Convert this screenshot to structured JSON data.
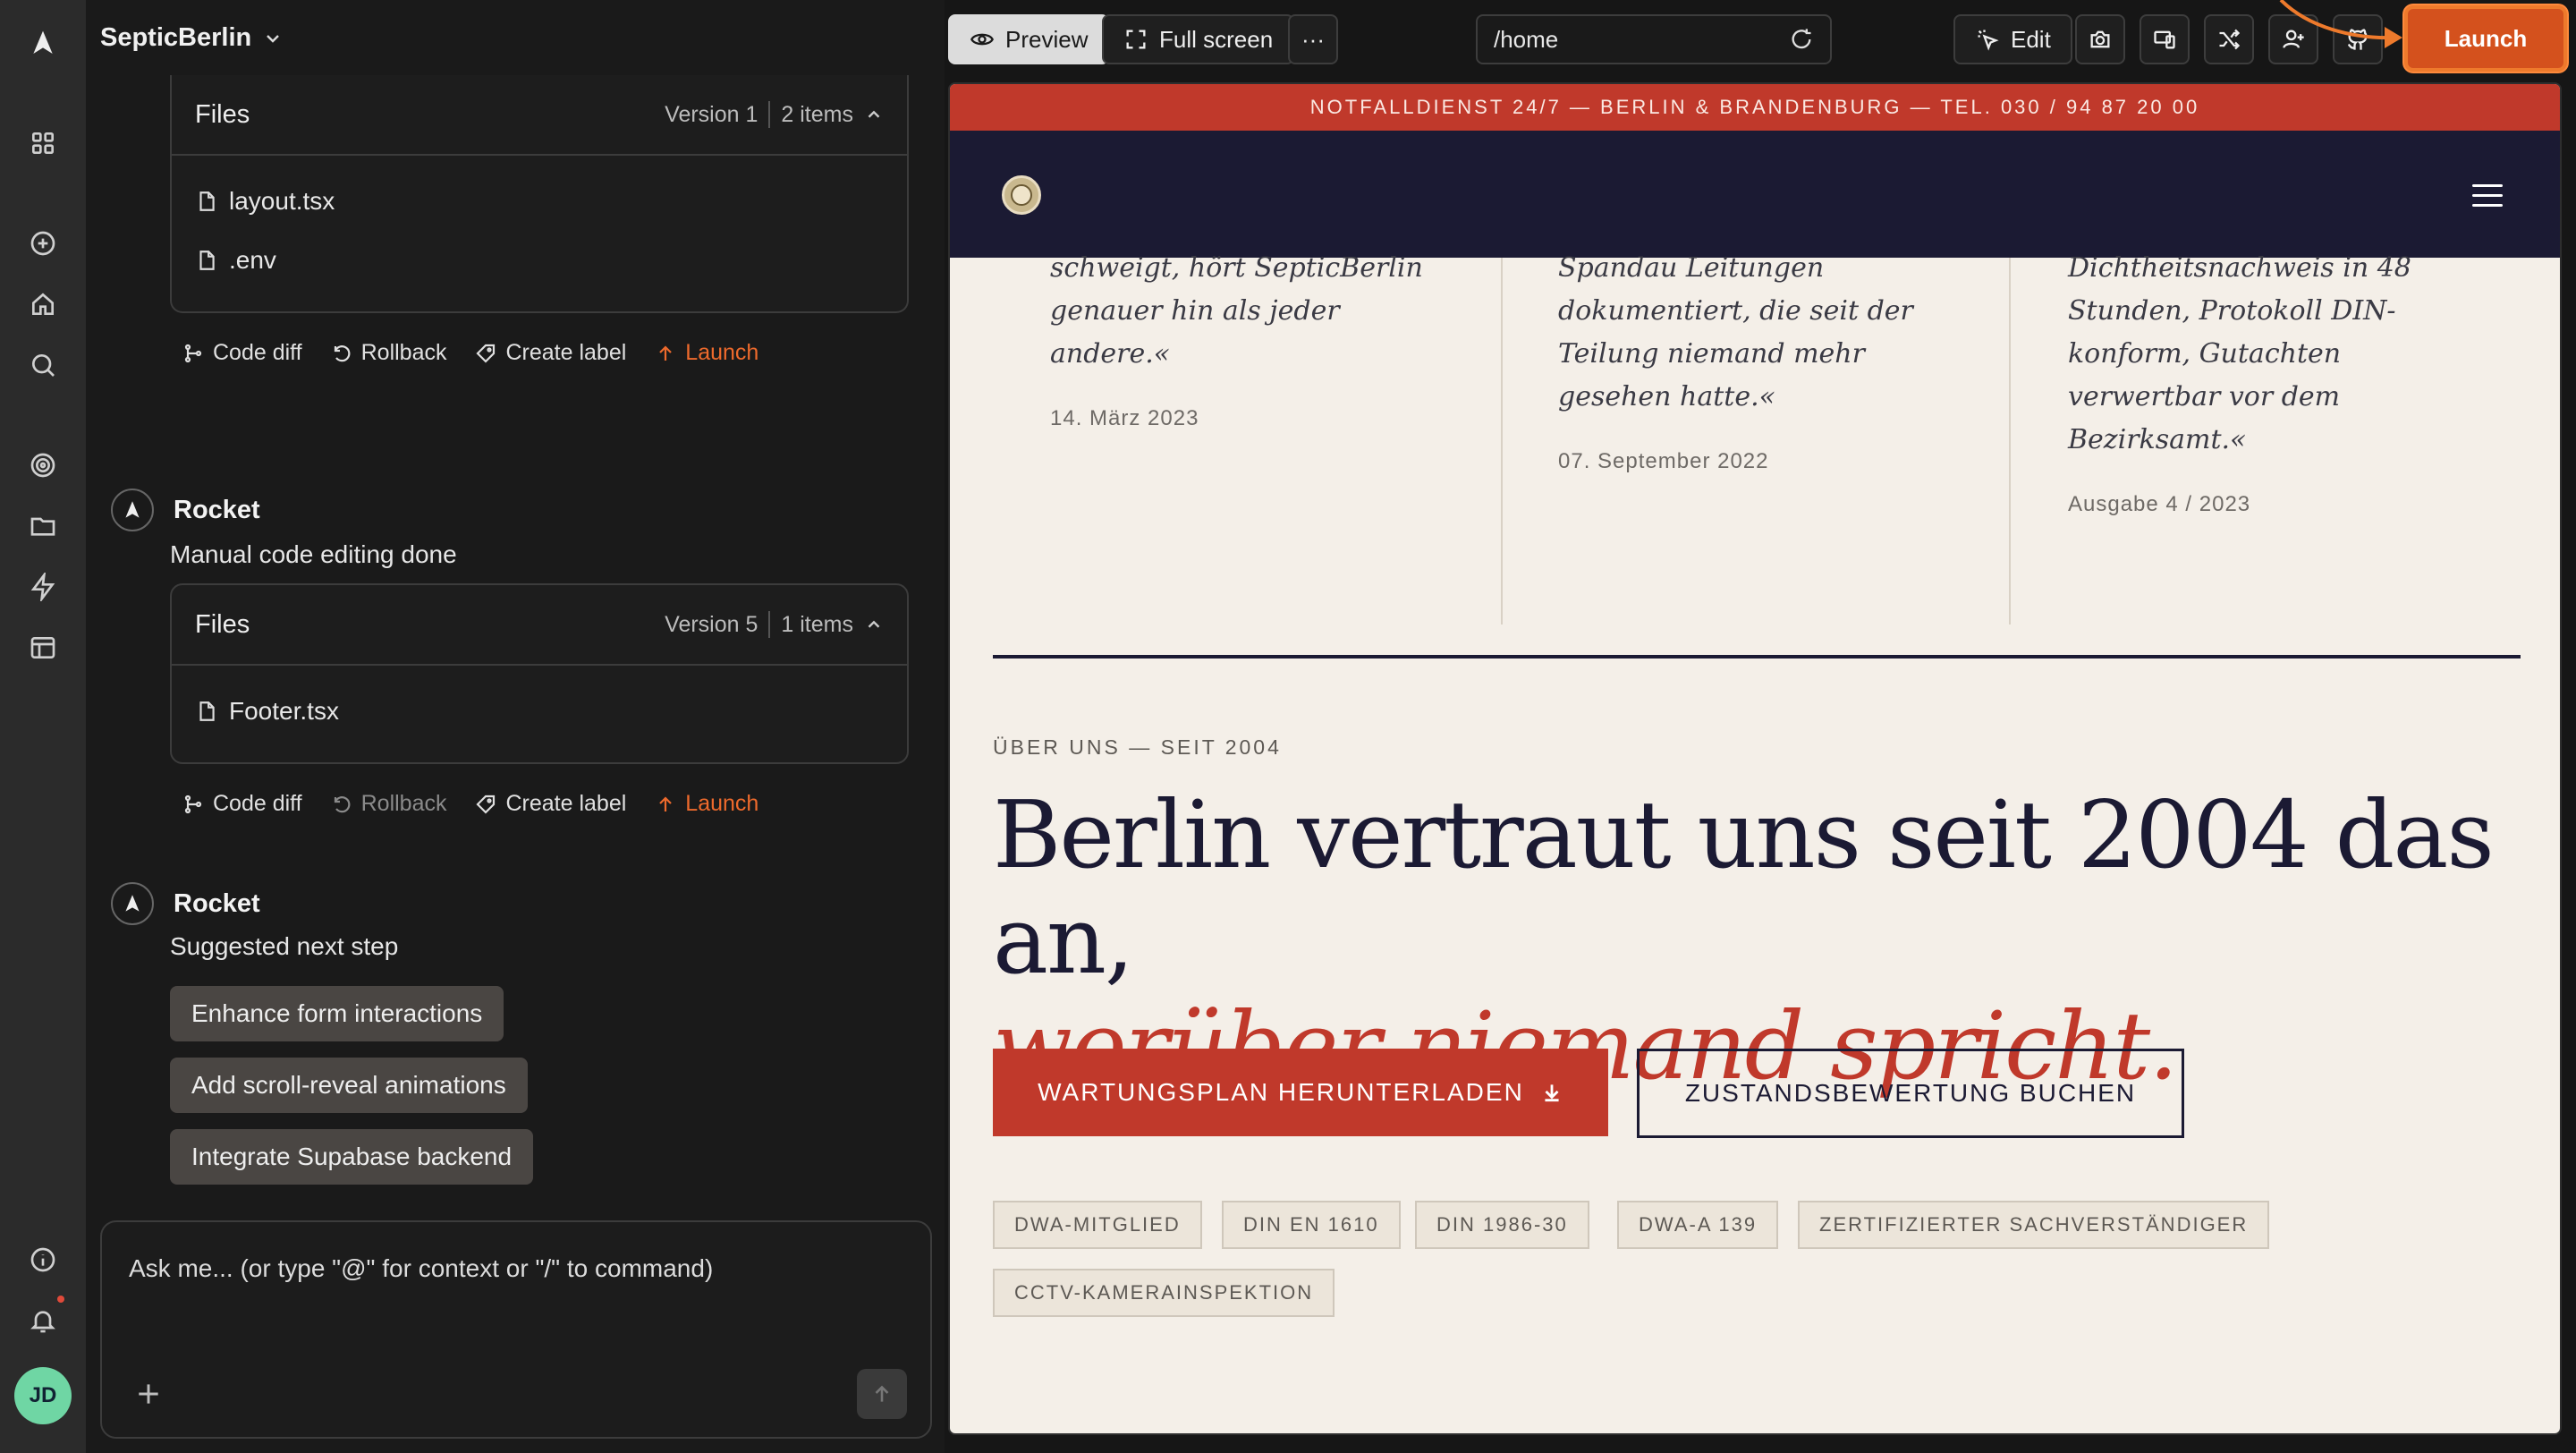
{
  "app": {
    "project_name": "SepticBerlin"
  },
  "rail": {
    "avatar_initials": "JD"
  },
  "chat": {
    "block1": {
      "files_title": "Files",
      "version": "Version 1",
      "count": "2 items",
      "files": [
        "layout.tsx",
        ".env"
      ],
      "actions": {
        "code_diff": "Code diff",
        "rollback": "Rollback",
        "create_label": "Create label",
        "launch": "Launch"
      }
    },
    "msg2": {
      "author": "Rocket",
      "text": "Manual code editing done",
      "files_title": "Files",
      "version": "Version 5",
      "count": "1 items",
      "files": [
        "Footer.tsx"
      ],
      "actions": {
        "code_diff": "Code diff",
        "rollback": "Rollback",
        "create_label": "Create label",
        "launch": "Launch"
      }
    },
    "msg3": {
      "author": "Rocket",
      "text": "Suggested next step",
      "suggestions": [
        "Enhance form interactions",
        "Add scroll-reveal animations",
        "Integrate Supabase backend"
      ]
    },
    "composer": {
      "placeholder": "Ask me... (or type \"@\" for context or \"/\" to command)"
    }
  },
  "toolbar": {
    "preview": "Preview",
    "full_screen": "Full screen",
    "more": "···",
    "url": "/home",
    "edit": "Edit",
    "launch": "Launch"
  },
  "site": {
    "banner": "NOTFALLDIENST 24/7 — BERLIN & BRANDENBURG — TEL. 030 / 94 87 20 00",
    "quotes": [
      {
        "text": "schweigt, hört SepticBerlin genauer hin als jeder andere.«",
        "date": "14. März 2023"
      },
      {
        "text": "Spandau Leitungen dokumentiert, die seit der Teilung niemand mehr gesehen hatte.«",
        "date": "07. September 2022"
      },
      {
        "text": "Dichtheitsnachweis in 48 Stunden, Protokoll DIN-konform, Gutachten verwertbar vor dem Bezirksamt.«",
        "date": "Ausgabe 4 / 2023"
      }
    ],
    "kicker": "ÜBER UNS — SEIT 2004",
    "headline_1": "Berlin vertraut uns seit 2004 das an,",
    "headline_2": "worüber niemand spricht.",
    "cta_primary": "WARTUNGSPLAN HERUNTERLADEN",
    "cta_secondary": "ZUSTANDSBEWERTUNG BUCHEN",
    "tags": [
      "DWA-MITGLIED",
      "DIN EN 1610",
      "DIN 1986-30",
      "DWA-A 139",
      "ZERTIFIZIERTER SACHVERSTÄNDIGER",
      "CCTV-KAMERAINSPEKTION"
    ]
  },
  "colors": {
    "accent_launch": "#d4511d",
    "site_red": "#c0392b",
    "site_navy": "#1b1a33",
    "site_bg": "#f4efe8"
  }
}
